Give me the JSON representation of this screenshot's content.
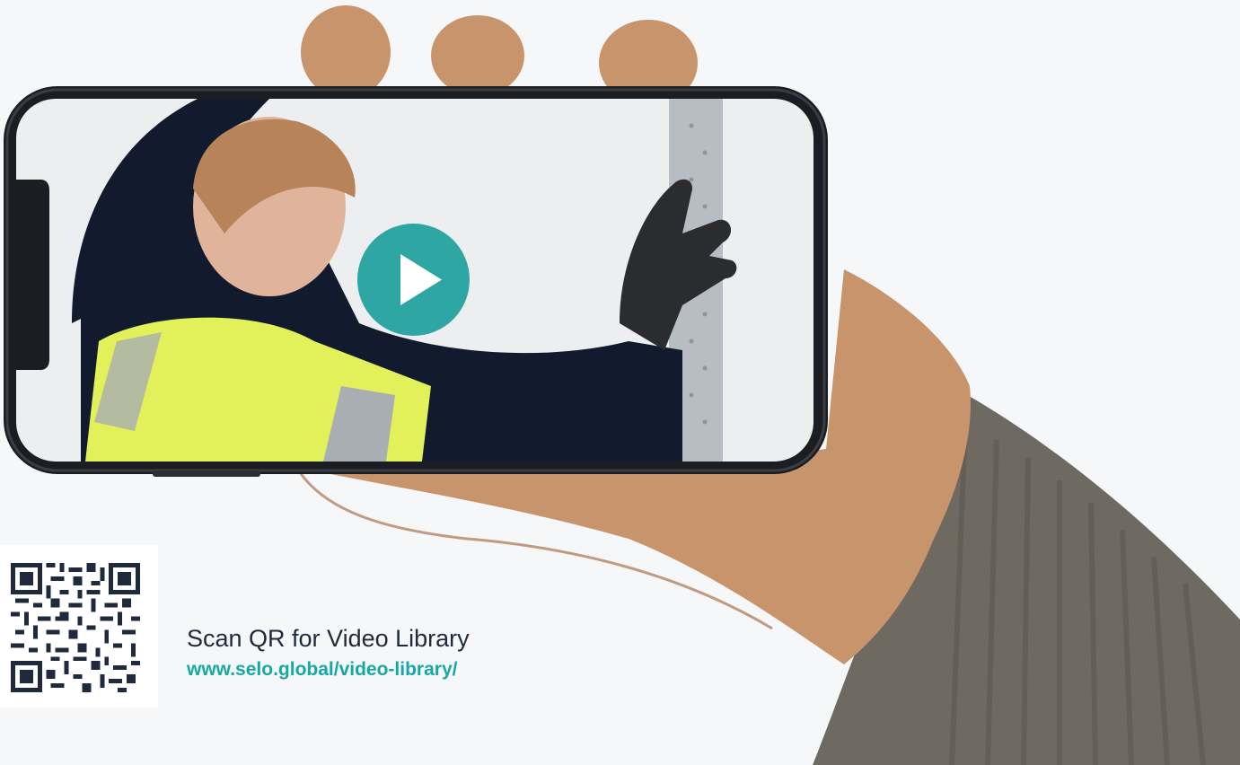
{
  "colors": {
    "background": "#f6f7f9",
    "accent": "#17a8a5",
    "play_button": "#2ea6a3",
    "text_dark": "#1f2b3d",
    "sleeve": "#6e6a62",
    "skin": "#c8946b",
    "hi_vis": "#e2f05a"
  },
  "hero": {
    "icons": {
      "phone": "smartphone-icon",
      "play": "play-icon"
    }
  },
  "qr": {
    "icon": "qr-code-icon"
  },
  "cta": {
    "title": "Scan QR for Video Library",
    "link_text": "www.selo.global/video-library/"
  }
}
